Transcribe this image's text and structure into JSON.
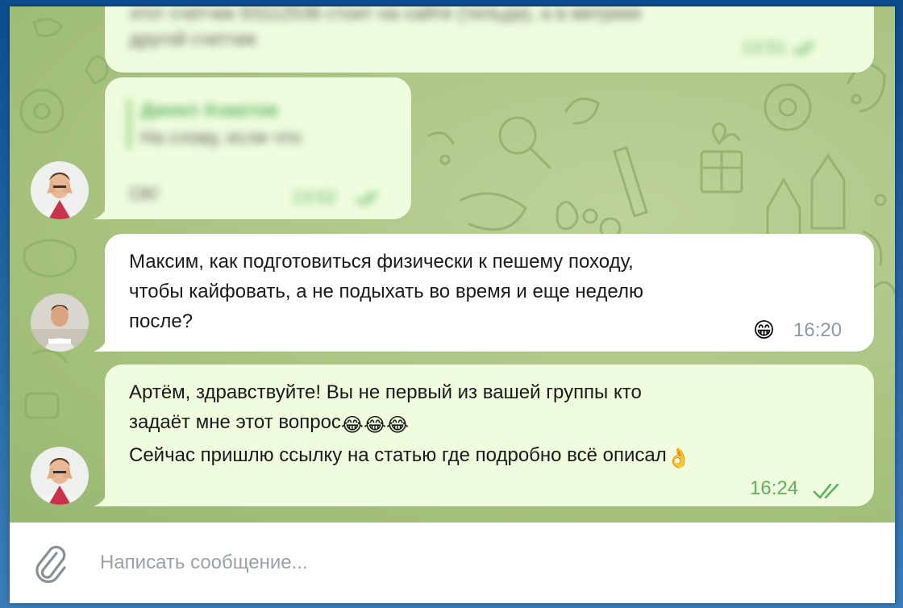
{
  "messages": [
    {
      "id": "m1",
      "direction": "outgoing",
      "blurred": true,
      "text": "этот счетчик 93112536 стоит на сайте (тильда), а в метрике\nдругой счетчик",
      "time": "13:51",
      "read": true
    },
    {
      "id": "m2",
      "direction": "outgoing",
      "blurred": true,
      "quote_author": "Данил Азаатов",
      "quote_text": "На слову, если что",
      "text": "ОК!",
      "time": "13:52",
      "read": true
    },
    {
      "id": "m3",
      "direction": "incoming",
      "blurred": false,
      "text": "Максим, как подготовиться физически к пешему походу,\nчтобы кайфовать, а не подыхать во время и еще неделю\nпосле?",
      "reaction": "😁",
      "time": "16:20"
    },
    {
      "id": "m4",
      "direction": "outgoing",
      "blurred": false,
      "line1": "Артём, здравствуйте! Вы не первый из вашей группы кто",
      "line2": "задаёт мне этот вопрос",
      "line2_emoji": "😂😂😂",
      "line3": "Сейчас пришлю ссылку на статью где подробно всё описал",
      "line3_emoji": "👌",
      "time": "16:24",
      "read": true
    }
  ],
  "composer": {
    "placeholder": "Написать сообщение..."
  },
  "colors": {
    "outgoing_bubble": "#effdde",
    "incoming_bubble": "#ffffff",
    "read_check": "#5db160",
    "chat_background": "#a9c481"
  }
}
